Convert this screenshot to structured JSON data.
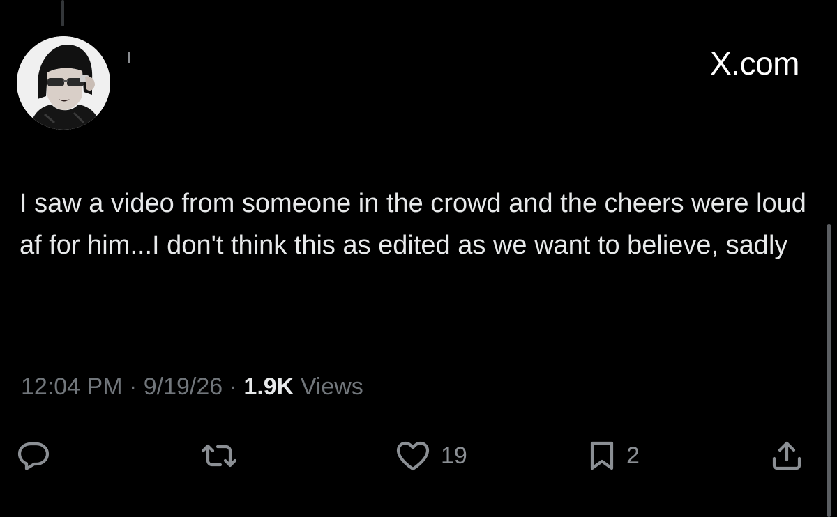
{
  "source_label": "X.com",
  "tweet": {
    "text": "I saw a video from someone in the crowd and the cheers were loud af for him...I don't think this as edited as we want to believe, sadly",
    "time": "12:04 PM",
    "separator": " · ",
    "date": "9/19/26",
    "views_count": "1.9K",
    "views_label": " Views"
  },
  "actions": {
    "reply": {
      "icon": "reply-icon",
      "count": ""
    },
    "repost": {
      "icon": "repost-icon",
      "count": ""
    },
    "like": {
      "icon": "heart-icon",
      "count": "19"
    },
    "bookmark": {
      "icon": "bookmark-icon",
      "count": "2"
    },
    "share": {
      "icon": "share-icon"
    }
  },
  "colors": {
    "background": "#000000",
    "text": "#e7e9ea",
    "muted": "#71767b",
    "icon": "#8b8f94"
  }
}
